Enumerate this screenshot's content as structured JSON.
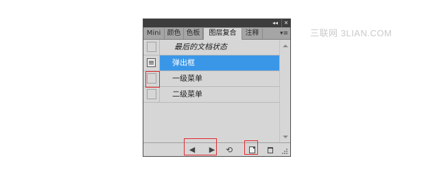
{
  "watermark": "三联网 3LIAN.COM",
  "panel": {
    "titlebar": {
      "collapse_glyph": "◂◂",
      "close_glyph": "✕"
    },
    "tabs": [
      {
        "label": "Mini",
        "active": false
      },
      {
        "label": "颜色",
        "active": false
      },
      {
        "label": "色板",
        "active": false
      },
      {
        "label": "图层复合",
        "active": true
      },
      {
        "label": "注释",
        "active": false
      }
    ],
    "menu_glyph": "▾≡",
    "rows": [
      {
        "label": "最后的文档状态",
        "italic": true,
        "selected": false,
        "icon": "checkbox"
      },
      {
        "label": "弹出框",
        "italic": false,
        "selected": true,
        "icon": "layer-comp-icon"
      },
      {
        "label": "一级菜单",
        "italic": false,
        "selected": false,
        "icon": "checkbox"
      },
      {
        "label": "二级菜单",
        "italic": false,
        "selected": false,
        "icon": "checkbox"
      }
    ],
    "bottom": {
      "prev_glyph": "◀",
      "next_glyph": "▶",
      "update_glyph": "⟲"
    }
  },
  "highlight_color": "#e3262b",
  "selected_color": "#3a97e8"
}
